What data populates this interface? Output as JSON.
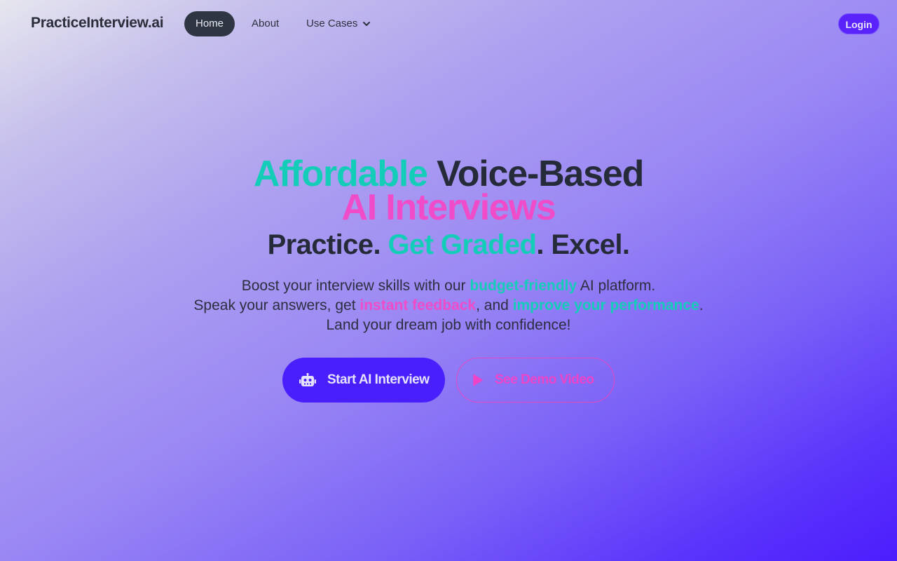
{
  "nav": {
    "brand": "PracticeInterview.ai",
    "items": [
      {
        "label": "Home",
        "active": true
      },
      {
        "label": "About"
      },
      {
        "label": "Use Cases"
      }
    ],
    "login_label": "Login"
  },
  "hero": {
    "line1": {
      "highlight": "Affordable",
      "rest": " Voice-Based"
    },
    "line2": "AI Interviews",
    "line3": {
      "part1": "Practice. ",
      "highlight": "Get Graded",
      "part2": ". Excel."
    },
    "sub1": {
      "pre": "Boost your interview skills with our ",
      "highlight": "budget-friendly",
      "post": " AI platform."
    },
    "sub2": {
      "pre": "Speak your answers, get ",
      "highlight1": "instant feedback",
      "mid": ", and ",
      "highlight2": "improve your performance",
      "post": "."
    },
    "sub3": "Land your dream job with confidence!",
    "start_label": "Start AI Interview",
    "demo_label": "See Demo Video"
  },
  "colors": {
    "teal": "#14cdb8",
    "pink": "#f04bc8",
    "primary": "#4a1ffd",
    "dark": "#262b3a"
  },
  "icons": {
    "start": "robot-icon",
    "demo": "play-icon",
    "use_cases": "chevron-down-icon"
  }
}
